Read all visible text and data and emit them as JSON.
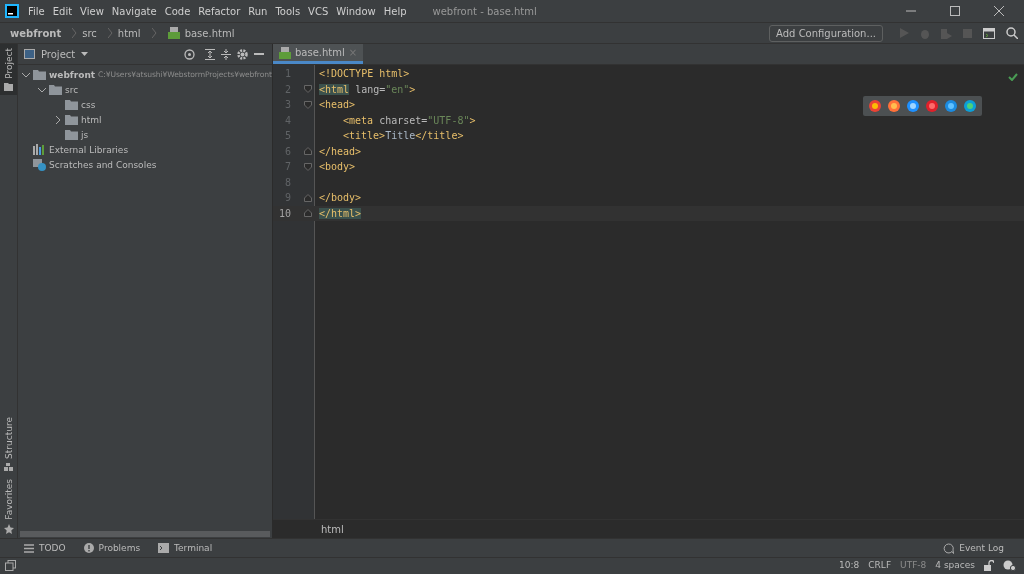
{
  "window": {
    "title": "webfront - base.html",
    "menu": [
      "File",
      "Edit",
      "View",
      "Navigate",
      "Code",
      "Refactor",
      "Run",
      "Tools",
      "VCS",
      "Window",
      "Help"
    ]
  },
  "breadcrumb": [
    {
      "label": "webfront",
      "bold": true,
      "file": false
    },
    {
      "label": "src",
      "bold": false,
      "file": false
    },
    {
      "label": "html",
      "bold": false,
      "file": false
    },
    {
      "label": "base.html",
      "bold": false,
      "file": true
    }
  ],
  "run_config": {
    "label": "Add Configuration..."
  },
  "left_strip": {
    "top": [
      {
        "label": "Project",
        "selected": true
      }
    ],
    "bottom": [
      {
        "label": "Structure",
        "selected": false
      },
      {
        "label": "Favorites",
        "selected": false
      }
    ]
  },
  "project_panel": {
    "title": "Project",
    "tree": [
      {
        "label": "webfront",
        "hint": "C:¥Users¥atsushi¥WebstormProjects¥webfront",
        "kind": "folder",
        "bold": true,
        "expanded": true,
        "children": [
          {
            "label": "src",
            "kind": "folder",
            "bold": false,
            "expanded": true,
            "children": [
              {
                "label": "css",
                "kind": "folder",
                "bold": false
              },
              {
                "label": "html",
                "kind": "folder",
                "bold": false,
                "expanded": false
              },
              {
                "label": "js",
                "kind": "folder",
                "bold": false
              }
            ]
          }
        ]
      },
      {
        "label": "External Libraries",
        "kind": "library",
        "bold": false
      },
      {
        "label": "Scratches and Consoles",
        "kind": "scratch",
        "bold": false
      }
    ]
  },
  "editor": {
    "tabs": [
      {
        "label": "base.html",
        "selected": true,
        "close": "×"
      }
    ],
    "lines": [
      {
        "number": "1",
        "current": false,
        "fold_start": false,
        "fold_end": false,
        "indented": false,
        "tokens": [
          {
            "text": "<!DOCTYPE html>",
            "kind": "tag",
            "matched": false
          }
        ]
      },
      {
        "number": "2",
        "current": false,
        "fold_start": true,
        "fold_end": false,
        "indented": false,
        "tokens": [
          {
            "text": "<html",
            "kind": "tag",
            "matched": true
          },
          {
            "text": " lang=",
            "kind": "attr",
            "matched": false
          },
          {
            "text": "\"en\"",
            "kind": "value",
            "matched": false
          },
          {
            "text": ">",
            "kind": "tag",
            "matched": false
          }
        ]
      },
      {
        "number": "3",
        "current": false,
        "fold_start": true,
        "fold_end": false,
        "indented": false,
        "tokens": [
          {
            "text": "<head>",
            "kind": "tag",
            "matched": false
          }
        ]
      },
      {
        "number": "4",
        "current": false,
        "fold_start": false,
        "fold_end": false,
        "indented": true,
        "tokens": [
          {
            "text": "<meta",
            "kind": "tag",
            "matched": false
          },
          {
            "text": " charset=",
            "kind": "attr",
            "matched": false
          },
          {
            "text": "\"UTF-8\"",
            "kind": "value",
            "matched": false
          },
          {
            "text": ">",
            "kind": "tag",
            "matched": false
          }
        ]
      },
      {
        "number": "5",
        "current": false,
        "fold_start": false,
        "fold_end": false,
        "indented": true,
        "tokens": [
          {
            "text": "<title>",
            "kind": "tag",
            "matched": false
          },
          {
            "text": "Title",
            "kind": "text",
            "matched": false
          },
          {
            "text": "</title>",
            "kind": "tag",
            "matched": false
          }
        ]
      },
      {
        "number": "6",
        "current": false,
        "fold_start": false,
        "fold_end": true,
        "indented": false,
        "tokens": [
          {
            "text": "</head>",
            "kind": "tag",
            "matched": false
          }
        ]
      },
      {
        "number": "7",
        "current": false,
        "fold_start": true,
        "fold_end": false,
        "indented": false,
        "tokens": [
          {
            "text": "<body>",
            "kind": "tag",
            "matched": false
          }
        ]
      },
      {
        "number": "8",
        "current": false,
        "fold_start": false,
        "fold_end": false
      },
      {
        "number": "9",
        "current": false,
        "fold_start": false,
        "fold_end": true,
        "indented": false,
        "tokens": [
          {
            "text": "</body>",
            "kind": "tag",
            "matched": false
          }
        ]
      },
      {
        "number": "10",
        "current": true,
        "fold_start": false,
        "fold_end": true,
        "indented": false,
        "tokens": [
          {
            "text": "</html>",
            "kind": "tag",
            "matched": true
          }
        ]
      }
    ],
    "footer_breadcrumb": "html"
  },
  "bottom_tools": [
    {
      "label": "TODO",
      "kind": "list"
    },
    {
      "label": "Problems",
      "kind": "problems"
    },
    {
      "label": "Terminal",
      "kind": "terminal"
    }
  ],
  "event_log": "Event Log",
  "status_bar": [
    {
      "label": "10:8",
      "disabled": false
    },
    {
      "label": "CRLF",
      "disabled": false
    },
    {
      "label": "UTF-8",
      "disabled": true
    },
    {
      "label": "4 spaces",
      "disabled": false
    }
  ]
}
